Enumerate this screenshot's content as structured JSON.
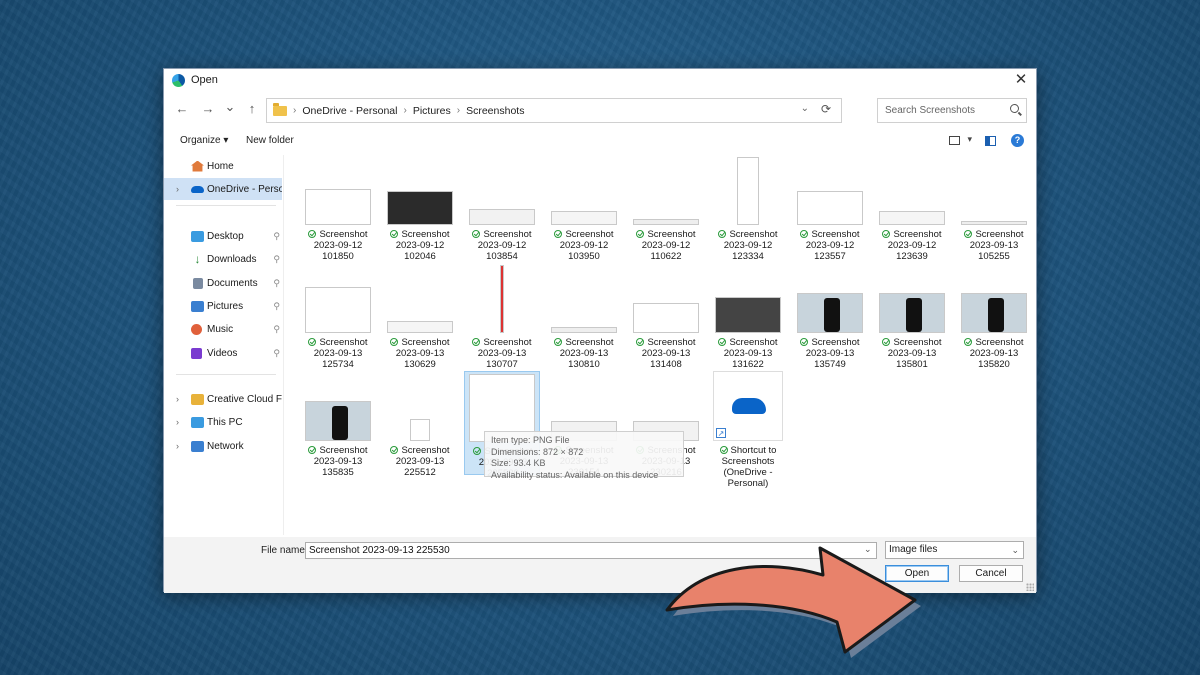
{
  "window": {
    "title": "Open",
    "close_glyph": "✕"
  },
  "nav": {
    "back": "←",
    "forward": "→",
    "recent": "⌄",
    "up": "↑"
  },
  "address": {
    "crumbs": [
      "OneDrive - Personal",
      "Pictures",
      "Screenshots"
    ],
    "separator": "›",
    "dropdown": "⌄",
    "refresh": "⟳"
  },
  "search": {
    "placeholder": "Search Screenshots"
  },
  "toolbar": {
    "organize": "Organize ▾",
    "new_folder": "New folder",
    "view_dd": "▾",
    "help": "?"
  },
  "sidebar": {
    "items": [
      {
        "label": "Home",
        "icon": "home-icon",
        "color": "#e07a3b"
      },
      {
        "label": "OneDrive - Personal",
        "icon": "cloud-icon",
        "color": "#0a64c8"
      },
      {
        "label": "Desktop",
        "icon": "desktop-icon",
        "color": "#3a9be0"
      },
      {
        "label": "Downloads",
        "icon": "download-icon",
        "color": "#2a8a3a"
      },
      {
        "label": "Documents",
        "icon": "documents-icon",
        "color": "#7a8aa0"
      },
      {
        "label": "Pictures",
        "icon": "pictures-icon",
        "color": "#3a7fd0"
      },
      {
        "label": "Music",
        "icon": "music-icon",
        "color": "#e0603b"
      },
      {
        "label": "Videos",
        "icon": "videos-icon",
        "color": "#7a3bd0"
      },
      {
        "label": "Creative Cloud Files",
        "icon": "creative-cloud-icon",
        "color": "#e8b23a"
      },
      {
        "label": "This PC",
        "icon": "pc-icon",
        "color": "#3a9be0"
      },
      {
        "label": "Network",
        "icon": "network-icon",
        "color": "#3a7fd0"
      }
    ],
    "pin_glyph": "📌",
    "expander": "›"
  },
  "files": [
    {
      "line1": "Screenshot",
      "line2": "2023-09-12",
      "line3": "101850"
    },
    {
      "line1": "Screenshot",
      "line2": "2023-09-12",
      "line3": "102046"
    },
    {
      "line1": "Screenshot",
      "line2": "2023-09-12",
      "line3": "103854"
    },
    {
      "line1": "Screenshot",
      "line2": "2023-09-12",
      "line3": "103950"
    },
    {
      "line1": "Screenshot",
      "line2": "2023-09-12",
      "line3": "110622"
    },
    {
      "line1": "Screenshot",
      "line2": "2023-09-12",
      "line3": "123334"
    },
    {
      "line1": "Screenshot",
      "line2": "2023-09-12",
      "line3": "123557"
    },
    {
      "line1": "Screenshot",
      "line2": "2023-09-12",
      "line3": "123639"
    },
    {
      "line1": "Screenshot",
      "line2": "2023-09-13",
      "line3": "105255"
    },
    {
      "line1": "Screenshot",
      "line2": "2023-09-13",
      "line3": "125734"
    },
    {
      "line1": "Screenshot",
      "line2": "2023-09-13",
      "line3": "130629"
    },
    {
      "line1": "Screenshot",
      "line2": "2023-09-13",
      "line3": "130707"
    },
    {
      "line1": "Screenshot",
      "line2": "2023-09-13",
      "line3": "130810"
    },
    {
      "line1": "Screenshot",
      "line2": "2023-09-13",
      "line3": "131408"
    },
    {
      "line1": "Screenshot",
      "line2": "2023-09-13",
      "line3": "131622"
    },
    {
      "line1": "Screenshot",
      "line2": "2023-09-13",
      "line3": "135749"
    },
    {
      "line1": "Screenshot",
      "line2": "2023-09-13",
      "line3": "135801"
    },
    {
      "line1": "Screenshot",
      "line2": "2023-09-13",
      "line3": "135820"
    },
    {
      "line1": "Screenshot",
      "line2": "2023-09-13",
      "line3": "135835"
    },
    {
      "line1": "Screenshot",
      "line2": "2023-09-13",
      "line3": "225512"
    },
    {
      "line1": "Screenshot",
      "line2": "2023-09-13",
      "line3": "225530"
    },
    {
      "line1": "Screenshot",
      "line2": "2023-09-13",
      "line3": "230154"
    },
    {
      "line1": "Screenshot",
      "line2": "2023-09-13",
      "line3": "230216"
    },
    {
      "line1": "Shortcut to",
      "line2": "Screenshots",
      "line3": "(OneDrive -",
      "line4": "Personal)"
    }
  ],
  "tooltip": {
    "type": "Item type: PNG File",
    "dimensions": "Dimensions: 872 × 872",
    "size": "Size: 93.4 KB",
    "availability": "Availability status: Available on this device"
  },
  "footer": {
    "file_name_label": "File name:",
    "file_name_value": "Screenshot 2023-09-13 225530",
    "dropdown": "⌄",
    "filter": "Image files",
    "open": "Open",
    "cancel": "Cancel"
  },
  "colors": {
    "accent": "#0a64c8",
    "arrow": "#e8826b",
    "selection": "#cce4f7"
  }
}
